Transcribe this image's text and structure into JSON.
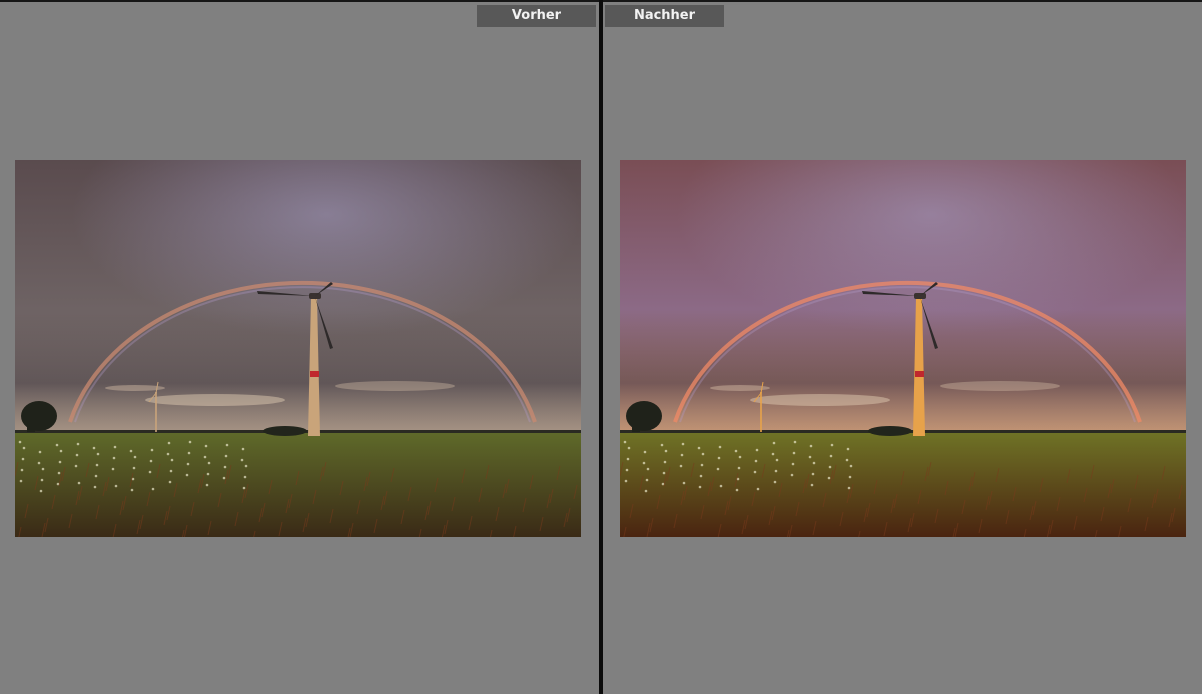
{
  "compare_view": {
    "before_label": "Vorher",
    "after_label": "Nachher",
    "before_photo": {
      "icon": "photo-rainbow-wind-turbine",
      "sky_top": "#5a4b4e",
      "sky_mid": "#6e6364",
      "sky_horizon": "#8a7a70",
      "field_top": "#5f6a2a",
      "field_bottom": "#3a2a16",
      "rainbow_color": "#c98a70",
      "turbine_color": "#c9a47a"
    },
    "after_photo": {
      "icon": "photo-rainbow-wind-turbine",
      "sky_top": "#7a4e55",
      "sky_mid": "#8c6a86",
      "sky_horizon": "#b57c58",
      "field_top": "#6f7326",
      "field_bottom": "#4a2410",
      "rainbow_color": "#f08a66",
      "turbine_color": "#e7a24a"
    }
  }
}
